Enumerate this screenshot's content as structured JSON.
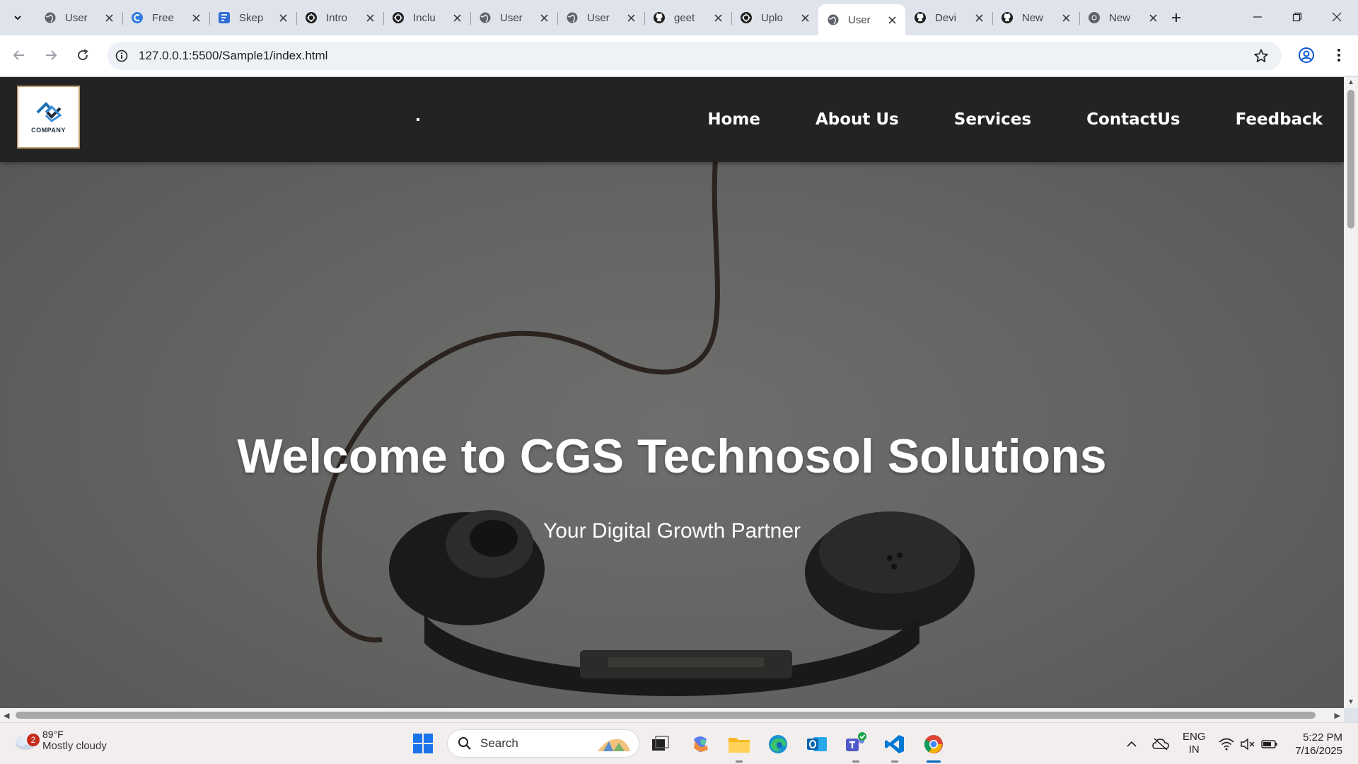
{
  "browser": {
    "tabs": [
      {
        "title": "User",
        "icon": "globe-icon",
        "active": false
      },
      {
        "title": "Free",
        "icon": "canva-icon",
        "active": false
      },
      {
        "title": "Skep",
        "icon": "forms-icon",
        "active": false
      },
      {
        "title": "Intro",
        "icon": "openai-icon",
        "active": false
      },
      {
        "title": "Inclu",
        "icon": "openai-icon",
        "active": false
      },
      {
        "title": "User",
        "icon": "globe-icon",
        "active": false
      },
      {
        "title": "User",
        "icon": "globe-icon",
        "active": false
      },
      {
        "title": "geet",
        "icon": "github-icon",
        "active": false
      },
      {
        "title": "Uplo",
        "icon": "openai-icon",
        "active": false
      },
      {
        "title": "User",
        "icon": "globe-icon",
        "active": true
      },
      {
        "title": "Devi",
        "icon": "github-icon",
        "active": false
      },
      {
        "title": "New",
        "icon": "github-icon",
        "active": false
      },
      {
        "title": "New",
        "icon": "chrome-icon",
        "active": false
      }
    ],
    "url": "127.0.0.1:5500/Sample1/index.html"
  },
  "site": {
    "logo_text": "COMPANY",
    "nav": [
      "Home",
      "About Us",
      "Services",
      "ContactUs",
      "Feedback"
    ],
    "hero_title": "Welcome to CGS Technosol Solutions",
    "hero_subtitle": "Your Digital Growth Partner"
  },
  "taskbar": {
    "weather_badge": "2",
    "temperature": "89°F",
    "condition": "Mostly cloudy",
    "search_label": "Search",
    "lang_line1": "ENG",
    "lang_line2": "IN",
    "time": "5:22 PM",
    "date": "7/16/2025"
  },
  "colors": {
    "site_nav_bg": "#232323",
    "hero_bg": "#646463",
    "taskbar_accent": "#0067c0"
  }
}
